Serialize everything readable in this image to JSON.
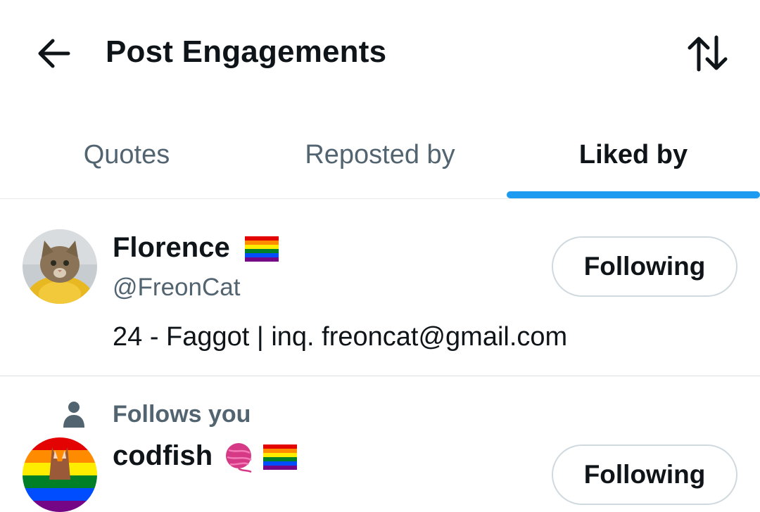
{
  "header": {
    "title": "Post Engagements",
    "back_icon": "arrow-left-icon",
    "sort_icon": "sort-arrows-icon"
  },
  "tabs": [
    {
      "label": "Quotes",
      "active": false
    },
    {
      "label": "Reposted by",
      "active": false
    },
    {
      "label": "Liked by",
      "active": true
    }
  ],
  "colors": {
    "accent": "#1d9bf0",
    "text_primary": "#0f1419",
    "text_secondary": "#536471",
    "border": "#cfd9de"
  },
  "users": [
    {
      "name": "Florence",
      "name_emoji": "rainbow-flag-icon",
      "handle": "@FreonCat",
      "bio": "24 - Faggot | inq. freoncat@gmail.com",
      "button_label": "Following"
    },
    {
      "context": "Follows you",
      "context_icon": "person-icon",
      "name": "codfish",
      "name_emoji": [
        "yarn-ball-icon",
        "rainbow-flag-icon"
      ],
      "button_label": "Following"
    }
  ]
}
